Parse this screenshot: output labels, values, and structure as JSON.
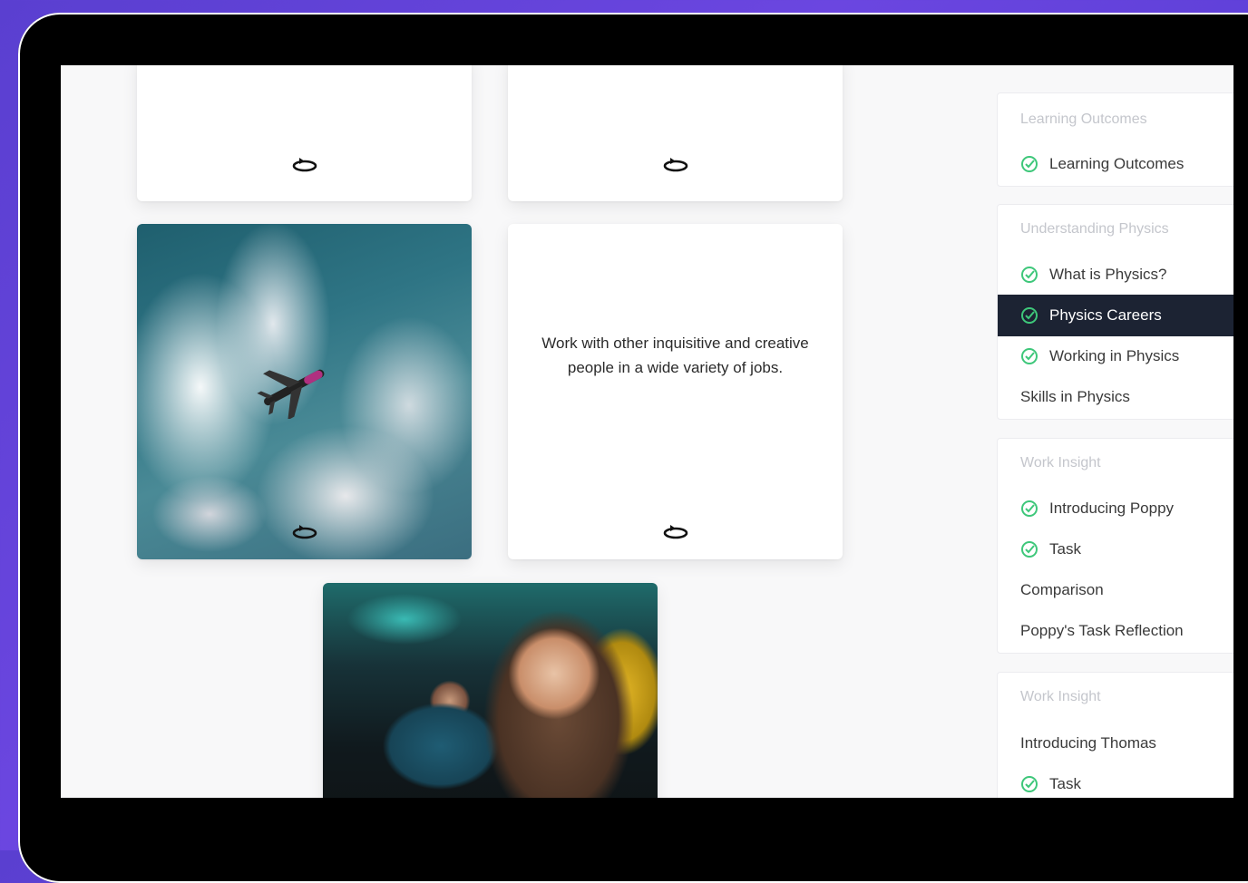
{
  "cards": {
    "flip_card_text": "Work with other inquisitive and creative people in a wide variety of jobs."
  },
  "sidebar": {
    "sections": [
      {
        "heading": "Learning Outcomes",
        "items": [
          {
            "label": "Learning Outcomes",
            "done": true
          }
        ]
      },
      {
        "heading": "Understanding Physics",
        "items": [
          {
            "label": "What is Physics?",
            "done": true
          },
          {
            "label": "Physics Careers",
            "done": true,
            "active": true
          },
          {
            "label": "Working in Physics",
            "done": true
          },
          {
            "label": "Skills in Physics",
            "done": false
          }
        ]
      },
      {
        "heading": "Work Insight",
        "items": [
          {
            "label": "Introducing Poppy",
            "done": true
          },
          {
            "label": "Task",
            "done": true
          },
          {
            "label": "Comparison",
            "done": false
          },
          {
            "label": "Poppy's Task Reflection",
            "done": false
          }
        ]
      },
      {
        "heading": "Work Insight",
        "items": [
          {
            "label": "Introducing Thomas",
            "done": false
          },
          {
            "label": "Task",
            "done": true
          }
        ]
      }
    ]
  },
  "colors": {
    "active_bg": "#1c2333",
    "check_green": "#3ec77a",
    "background_purple": "#5b3ed6"
  }
}
